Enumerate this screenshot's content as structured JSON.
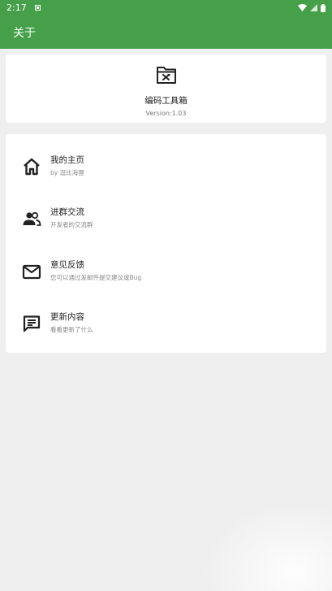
{
  "status": {
    "time": "2:17"
  },
  "toolbar": {
    "title": "关于"
  },
  "app": {
    "name": "编码工具箱",
    "version": "Version:1.03"
  },
  "items": [
    {
      "title": "我的主页",
      "subtitle": "by 逗比海狸",
      "icon": "home-icon"
    },
    {
      "title": "进群交流",
      "subtitle": "开发者的交流群",
      "icon": "group-icon"
    },
    {
      "title": "意见反馈",
      "subtitle": "您可以通过发邮件提交建议或Bug",
      "icon": "mail-icon"
    },
    {
      "title": "更新内容",
      "subtitle": "看看更新了什么",
      "icon": "message-icon"
    }
  ],
  "colors": {
    "primary": "#45a049",
    "background": "#efefef"
  }
}
